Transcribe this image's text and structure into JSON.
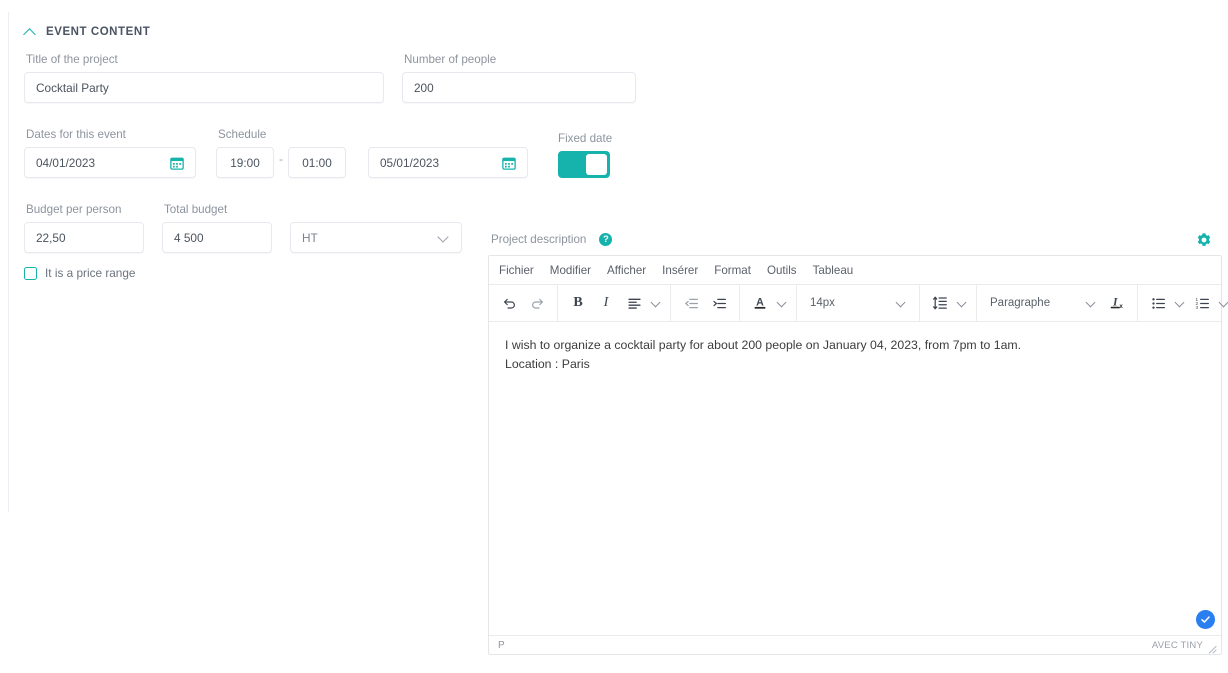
{
  "section": {
    "title": "EVENT CONTENT",
    "collapse_icon": "chevron-up-icon"
  },
  "fields": {
    "title_of_project": {
      "label": "Title of the project",
      "value": "Cocktail Party"
    },
    "number_of_people": {
      "label": "Number of people",
      "value": "200"
    },
    "dates_for_event": {
      "label": "Dates for this event",
      "start_value": "04/01/2023",
      "end_value": "05/01/2023",
      "icon": "calendar-icon"
    },
    "schedule": {
      "label": "Schedule",
      "start_time": "19:00",
      "separator": "-",
      "end_time": "01:00"
    },
    "fixed_date": {
      "label": "Fixed date",
      "state": "on"
    },
    "budget_per_person": {
      "label": "Budget per person",
      "value": "22,50"
    },
    "total_budget": {
      "label": "Total budget",
      "value": "4 500"
    },
    "tax_mode": {
      "value": "HT",
      "icon": "chevron-down-icon"
    },
    "price_range": {
      "label": "It is a price range",
      "checked": false
    }
  },
  "description": {
    "label": "Project description",
    "help_icon": "question-mark-icon",
    "settings_icon": "gear-icon"
  },
  "editor": {
    "menu": [
      "Fichier",
      "Modifier",
      "Afficher",
      "Insérer",
      "Format",
      "Outils",
      "Tableau"
    ],
    "toolbar": {
      "undo": "undo-icon",
      "redo": "redo-icon",
      "bold": "B",
      "italic": "I",
      "align": "align-left-icon",
      "outdent": "outdent-icon",
      "indent": "indent-icon",
      "text_color": "A",
      "font_size": "14px",
      "line_height": "line-height-icon",
      "block_format": "Paragraphe",
      "clear_format": "clear-formatting-icon",
      "bullet_list": "bullet-list-icon",
      "numbered_list": "numbered-list-icon",
      "more": "more-options-icon"
    },
    "body": [
      "I wish to organize a cocktail party for about 200 people on January 04, 2023, from 7pm to 1am.",
      "Location : Paris"
    ],
    "statusbar": {
      "path": "P",
      "brand": "AVEC TINY",
      "resize": "resize-handle-icon"
    },
    "saved_badge": "check-circle-icon"
  },
  "colors": {
    "accent": "#16b3ac",
    "badge_blue": "#2a7ff0",
    "label_gray": "#8d949e",
    "border": "#e7e9ee"
  }
}
